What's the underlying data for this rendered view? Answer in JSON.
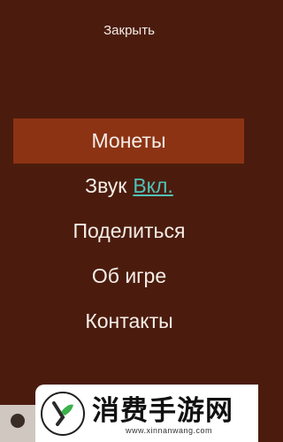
{
  "header": {
    "close_label": "Закрыть"
  },
  "menu": {
    "items": [
      {
        "key": "coins",
        "label": "Монеты",
        "active": true
      },
      {
        "key": "sound",
        "label": "Звук",
        "value": "Вкл."
      },
      {
        "key": "share",
        "label": "Поделиться"
      },
      {
        "key": "about",
        "label": "Об игре"
      },
      {
        "key": "contacts",
        "label": "Контакты"
      }
    ]
  },
  "colors": {
    "background": "#4b1c0e",
    "active_item": "#8c3314",
    "text": "#f6eee8",
    "sound_on": "#4fc2b8"
  },
  "watermark": {
    "title": "消费手游网",
    "url": "www.xinnanwang.com"
  }
}
